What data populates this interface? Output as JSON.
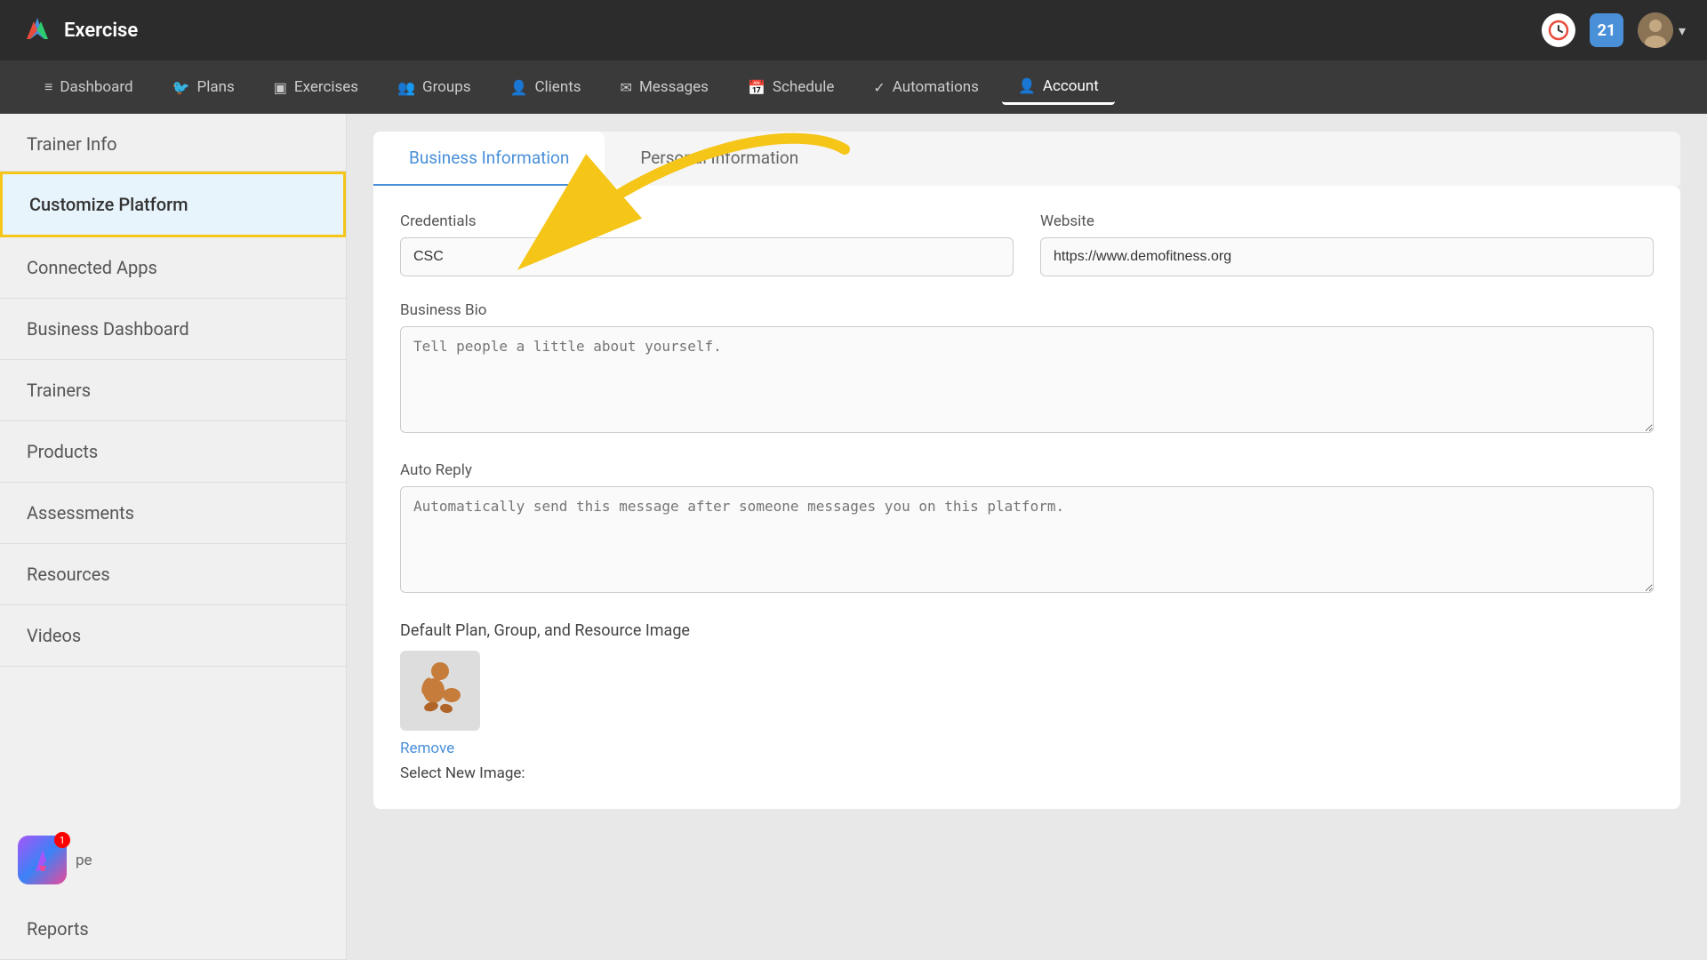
{
  "app": {
    "title": "Exercise",
    "logo_color": "#4a90d9"
  },
  "topbar": {
    "badge_count": "21",
    "chevron_label": "▾"
  },
  "navbar": {
    "items": [
      {
        "id": "dashboard",
        "label": "Dashboard",
        "icon": "≡"
      },
      {
        "id": "plans",
        "label": "Plans",
        "icon": "🐦"
      },
      {
        "id": "exercises",
        "label": "Exercises",
        "icon": "▣"
      },
      {
        "id": "groups",
        "label": "Groups",
        "icon": "👥"
      },
      {
        "id": "clients",
        "label": "Clients",
        "icon": "👤"
      },
      {
        "id": "messages",
        "label": "Messages",
        "icon": "✉"
      },
      {
        "id": "schedule",
        "label": "Schedule",
        "icon": "📅"
      },
      {
        "id": "automations",
        "label": "Automations",
        "icon": "✓"
      },
      {
        "id": "account",
        "label": "Account",
        "icon": "👤",
        "active": true
      }
    ]
  },
  "sidebar": {
    "trainer_info_label": "Trainer Info",
    "customize_platform_label": "Customize Platform",
    "connected_apps_label": "Connected Apps",
    "business_dashboard_label": "Business Dashboard",
    "trainers_label": "Trainers",
    "products_label": "Products",
    "assessments_label": "Assessments",
    "resources_label": "Resources",
    "videos_label": "Videos",
    "reports_label": "Reports",
    "footer_label": "pe"
  },
  "tabs": {
    "business_info_label": "Business Information",
    "personal_info_label": "Personal Information"
  },
  "form": {
    "credentials_label": "Credentials",
    "credentials_value": "CSC",
    "website_label": "Website",
    "website_value": "https://www.demofitness.org",
    "bio_label": "Business Bio",
    "bio_placeholder": "Tell people a little about yourself.",
    "auto_reply_label": "Auto Reply",
    "auto_reply_placeholder": "Automatically send this message after someone messages you on this platform.",
    "default_image_label": "Default Plan, Group, and Resource Image",
    "remove_label": "Remove",
    "select_new_image_label": "Select New Image:"
  },
  "notification": {
    "count": "1"
  }
}
